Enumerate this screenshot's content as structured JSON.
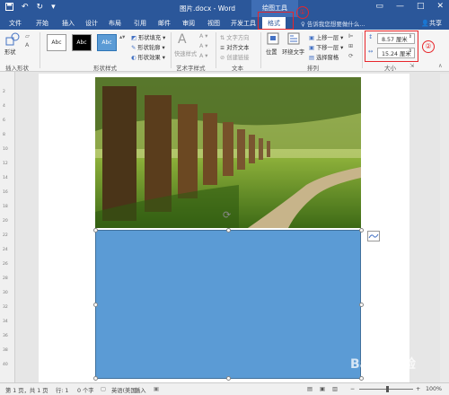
{
  "titlebar": {
    "title": "图片.docx - Word",
    "context_tab": "绘图工具",
    "qat_icons": [
      "save-icon",
      "undo-icon",
      "redo-icon",
      "customize-icon"
    ]
  },
  "tabs": [
    {
      "label": "文件"
    },
    {
      "label": "开始"
    },
    {
      "label": "插入"
    },
    {
      "label": "设计"
    },
    {
      "label": "布局"
    },
    {
      "label": "引用"
    },
    {
      "label": "邮件"
    },
    {
      "label": "审阅"
    },
    {
      "label": "视图"
    },
    {
      "label": "开发工具"
    },
    {
      "label": "格式"
    }
  ],
  "tell_me": "告诉我您想要做什么...",
  "share": "共享",
  "annotations": {
    "one": "①",
    "two": "②"
  },
  "ribbon": {
    "insert_shapes": {
      "shapes_label": "形状",
      "group": "插入形状"
    },
    "shape_styles": {
      "style_samples": [
        "Abc",
        "Abc",
        "Abc"
      ],
      "fill": "形状填充",
      "outline": "形状轮廓",
      "effects": "形状效果",
      "group": "形状样式"
    },
    "wordart": {
      "quick_styles": "快速样式",
      "group": "艺术字样式"
    },
    "text": {
      "direction": "文字方向",
      "align": "对齐文本",
      "link": "创建链接",
      "group": "文本"
    },
    "arrange": {
      "position": "位置",
      "wrap": "环绕文字",
      "bring_forward": "上移一层",
      "send_backward": "下移一层",
      "selection_pane": "选择窗格",
      "group": "排列"
    },
    "size": {
      "height": "8.57 厘米",
      "width": "15.24 厘米",
      "group": "大小"
    }
  },
  "ruler_numbers": [
    "2",
    "4",
    "6",
    "8",
    "10",
    "12",
    "14",
    "16",
    "18",
    "20",
    "22",
    "24",
    "26",
    "28",
    "30",
    "32",
    "34",
    "36",
    "38",
    "40"
  ],
  "statusbar": {
    "page": "第 1 页，共 1 页",
    "line": "行: 1",
    "words": "0 个字",
    "language": "英语(美国)",
    "mode": "插入",
    "zoom": "100%"
  },
  "watermark": "Baidu经验",
  "colors": {
    "word_blue": "#2b579a",
    "shape_fill": "#5b9bd5",
    "highlight_red": "#e8262b"
  }
}
